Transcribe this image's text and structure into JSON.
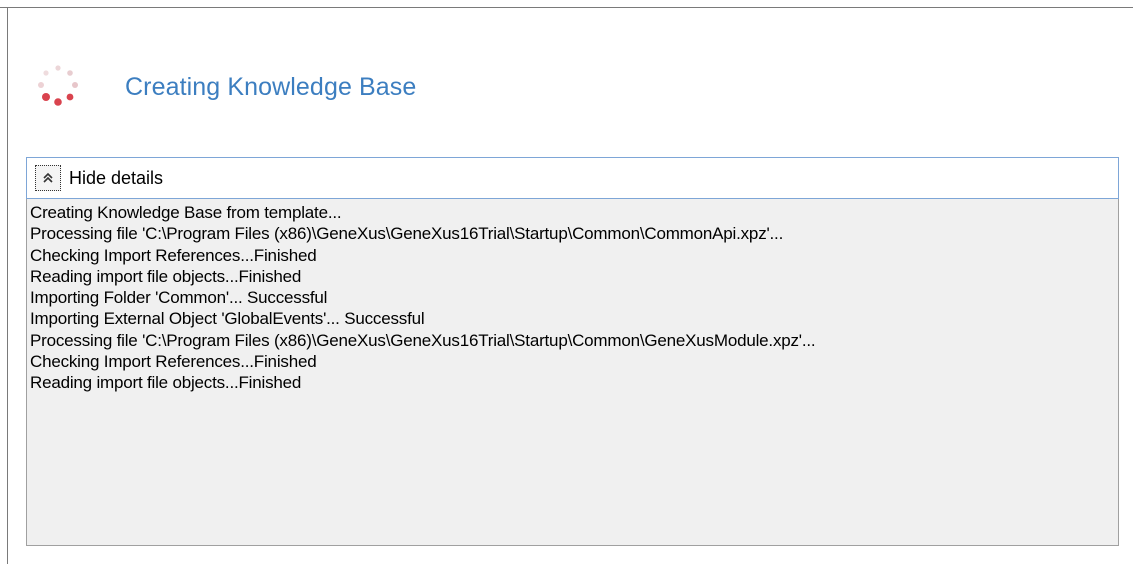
{
  "header": {
    "title": "Creating Knowledge Base"
  },
  "details": {
    "toggle_label": "Hide details",
    "log_lines": [
      "Creating Knowledge Base from template...",
      "Processing file 'C:\\Program Files (x86)\\GeneXus\\GeneXus16Trial\\Startup\\Common\\CommonApi.xpz'...",
      "Checking Import References...Finished",
      "Reading import file objects...Finished",
      "Importing Folder 'Common'... Successful",
      "Importing External Object 'GlobalEvents'... Successful",
      "Processing file 'C:\\Program Files (x86)\\GeneXus\\GeneXus16Trial\\Startup\\Common\\GeneXusModule.xpz'...",
      "Checking Import References...Finished",
      "Reading import file objects...Finished"
    ]
  },
  "icons": {
    "spinner": "loading-spinner-icon",
    "toggle": "double-chevron-up-icon"
  },
  "colors": {
    "title": "#3c7ec0",
    "spinner_active": "#d9434e",
    "spinner_inactive": "#e6c4c7",
    "log_background": "#f0f0f0",
    "header_border": "#7ea6d7"
  }
}
